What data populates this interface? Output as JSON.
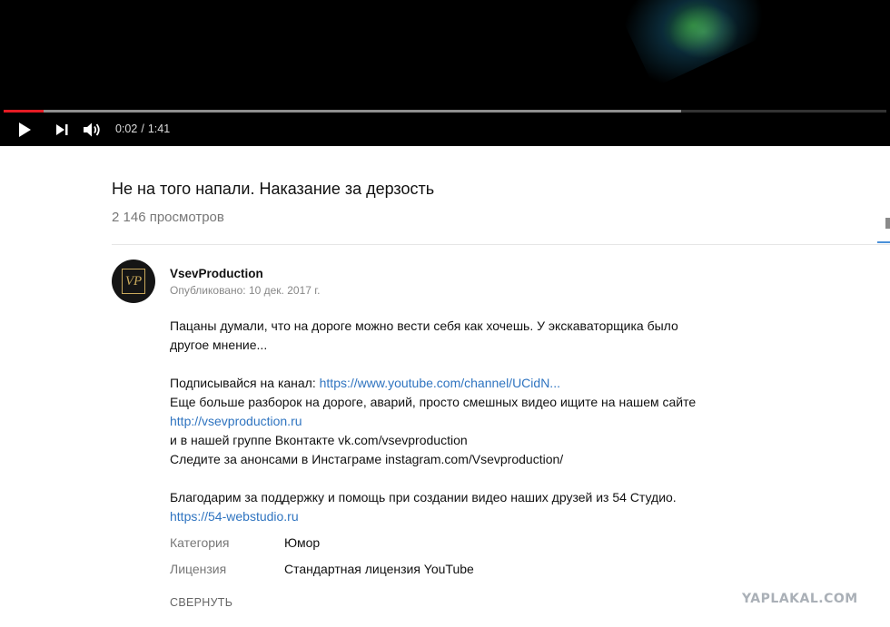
{
  "player": {
    "progress_played_fraction": 0.045,
    "progress_buffered_fraction": 0.767,
    "time_current": "0:02",
    "time_separator": "/",
    "time_total": "1:41"
  },
  "video": {
    "title": "Не на того напали. Наказание за дерзость",
    "views": "2 146 просмотров"
  },
  "channel": {
    "avatar_initials": "VP",
    "name": "VsevProduction",
    "published": "Опубликовано: 10 дек. 2017 г."
  },
  "description": {
    "line1": "Пацаны думали, что на дороге можно вести себя как хочешь. У экскаваторщика было",
    "line2": "другое мнение...",
    "line3_text": "Подписывайся на канал: ",
    "line3_link": "https://www.youtube.com/channel/UCidN...",
    "line4": "Еще больше разборок на дороге, аварий, просто смешных видео ищите на нашем сайте",
    "line5_link": "http://vsevproduction.ru",
    "line6": "и в нашей группе Вконтакте vk.com/vsevproduction",
    "line7": "Следите за анонсами в Инстаграме instagram.com/Vsevproduction/",
    "line8": "Благодарим за поддержку и помощь при создании видео наших друзей из 54 Студио.",
    "line9_link": "https://54-webstudio.ru"
  },
  "meta": {
    "category_label": "Категория",
    "category_value": "Юмор",
    "license_label": "Лицензия",
    "license_value": "Стандартная лицензия YouTube"
  },
  "collapse_label": "СВЕРНУТЬ",
  "watermark": "YAPLAKAL.COM",
  "colors": {
    "progress_played": "#e41b23",
    "link": "#2f74c0",
    "player_bg": "#000000"
  },
  "icons": [
    "play-icon",
    "next-icon",
    "volume-icon"
  ]
}
